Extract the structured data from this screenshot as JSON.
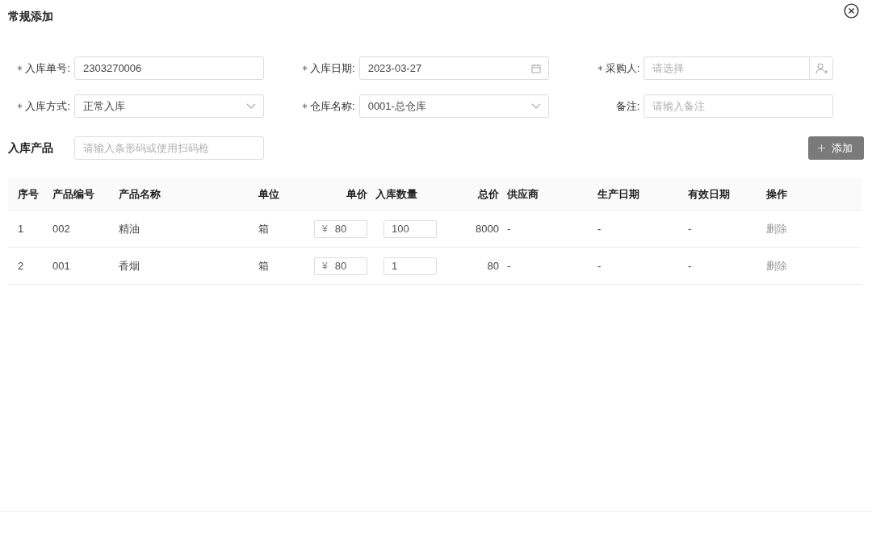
{
  "dialog": {
    "title": "常规添加"
  },
  "form": {
    "fields": [
      {
        "label": "入库单号:",
        "required": true,
        "kind": "text",
        "value": "2303270006"
      },
      {
        "label": "入库日期:",
        "required": true,
        "kind": "date",
        "value": "2023-03-27"
      },
      {
        "label": "采购人:",
        "required": true,
        "kind": "picker",
        "placeholder": "请选择"
      },
      {
        "label": "入库方式:",
        "required": true,
        "kind": "select",
        "value": "正常入库"
      },
      {
        "label": "仓库名称:",
        "required": true,
        "kind": "select",
        "value": "0001-总仓库"
      },
      {
        "label": "备注:",
        "required": false,
        "kind": "text",
        "placeholder": "请输入备注"
      }
    ]
  },
  "products": {
    "title": "入库产品",
    "scan_placeholder": "请输入条形码或使用扫码枪",
    "add_button": "添加"
  },
  "table": {
    "columns": [
      "序号",
      "产品编号",
      "产品名称",
      "单位",
      "单价",
      "入库数量",
      "总价",
      "供应商",
      "生产日期",
      "有效日期",
      "操作"
    ],
    "rows": [
      {
        "index": "1",
        "code": "002",
        "name": "精油",
        "unit": "箱",
        "price_prefix": "¥",
        "price": "80",
        "quantity": "100",
        "total": "8000",
        "supplier": "-",
        "production_date": "-",
        "expiry_date": "-",
        "action": "删除"
      },
      {
        "index": "2",
        "code": "001",
        "name": "香烟",
        "unit": "箱",
        "price_prefix": "¥",
        "price": "80",
        "quantity": "1",
        "total": "80",
        "supplier": "-",
        "production_date": "-",
        "expiry_date": "-",
        "action": "删除"
      }
    ]
  }
}
